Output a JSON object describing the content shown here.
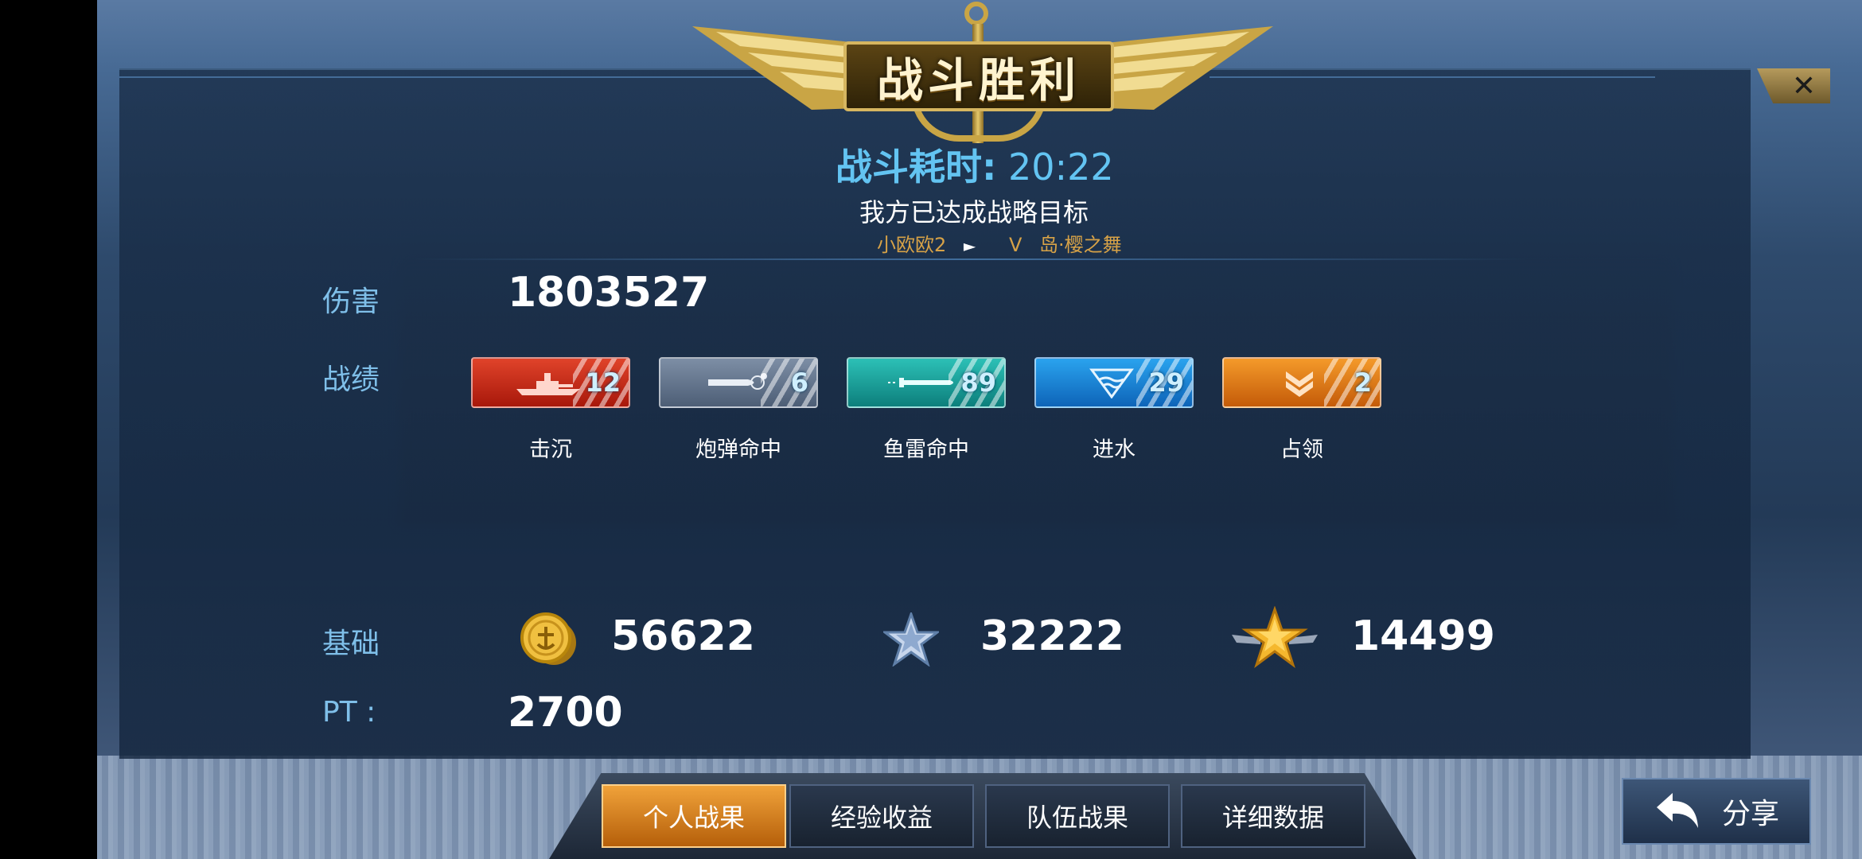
{
  "banner": {
    "title": "战斗胜利"
  },
  "close": {
    "symbol": "✕"
  },
  "battle": {
    "duration_label": "战斗耗时:",
    "duration_value": "20:22",
    "objective": "我方已达成战略目标",
    "player": "小欧欧2",
    "vs": "V",
    "map": "岛·樱之舞"
  },
  "damage": {
    "label": "伤害",
    "value": "1803527"
  },
  "record": {
    "label": "战绩",
    "badges": [
      {
        "label": "击沉",
        "count": "12",
        "icon": "warship-icon",
        "color": "#d2301b"
      },
      {
        "label": "炮弹命中",
        "count": "6",
        "icon": "shell-icon",
        "color": "#5f7089"
      },
      {
        "label": "鱼雷命中",
        "count": "89",
        "icon": "torpedo-icon",
        "color": "#1aa09b"
      },
      {
        "label": "进水",
        "count": "29",
        "icon": "water-icon",
        "color": "#1b84d6"
      },
      {
        "label": "占领",
        "count": "2",
        "icon": "chevron-rank-icon",
        "color": "#e27a14"
      }
    ]
  },
  "base": {
    "label": "基础",
    "coins": {
      "value": "56622",
      "icon": "gold-coin-icon"
    },
    "exp": {
      "value": "32222",
      "icon": "silver-star-icon"
    },
    "rank": {
      "value": "14499",
      "icon": "gold-winged-star-icon"
    }
  },
  "pt": {
    "label": "PT :",
    "value": "2700"
  },
  "tabs": [
    "个人战果",
    "经验收益",
    "队伍战果",
    "详细数据"
  ],
  "share": {
    "label": "分享",
    "icon": "return-arrow-icon"
  }
}
